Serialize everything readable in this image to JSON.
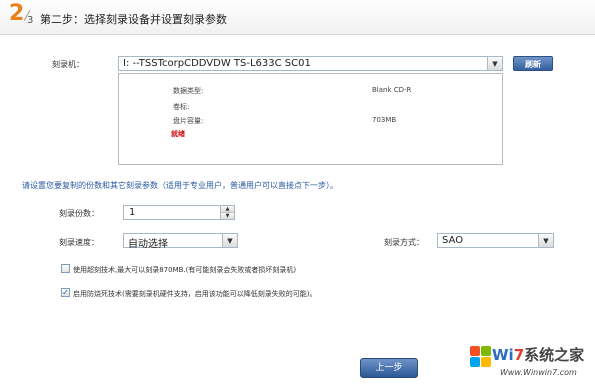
{
  "header": {
    "step_current": "2",
    "step_total": "3",
    "title": "第二步：选择刻录设备并设置刻录参数"
  },
  "drive": {
    "label": "刻录机：",
    "selected": "I:  --TSSTcorpCDDVDW TS-L633C  SC01",
    "refresh_label": "刷新"
  },
  "disc_info": {
    "data_type_label": "数据类型:",
    "data_type_value": "Blank CD-R",
    "volume_label": "卷标:",
    "volume_value": "",
    "capacity_label": "盘片容量:",
    "capacity_value": "703MB",
    "status": "就绪"
  },
  "hint": "请设置您要复制的份数和其它刻录参数（适用于专业用户，普通用户可以直接点下一步）。",
  "copies": {
    "label": "刻录份数：",
    "value": "1"
  },
  "speed": {
    "label": "刻录速度：",
    "value": "自动选择"
  },
  "mode": {
    "label": "刻录方式：",
    "value": "SAO"
  },
  "options": {
    "overburn_label": "使用超刻技术,最大可以刻录870MB.(有可能刻录会失败或者损坏刻录机)",
    "overburn_checked": false,
    "bufferproof_label": "启用防烧死技术(需要刻录机硬件支持，启用该功能可以降低刻录失败的可能)。",
    "bufferproof_checked": true
  },
  "footer": {
    "prev_label": "上一步"
  },
  "watermark": {
    "brand_pre": "Wi",
    "brand_seven": "7",
    "brand_post": "系统之家",
    "url": "Www.Winwin7.com"
  },
  "icons": {
    "dropdown": "chevron-down-icon",
    "spin_up": "caret-up-icon",
    "spin_down": "caret-down-icon",
    "check": "checkmark-icon"
  },
  "colors": {
    "accent": "#e8801b",
    "button": "#35609f",
    "hint_text": "#2a5aa0",
    "status_busy": "#d01010"
  }
}
